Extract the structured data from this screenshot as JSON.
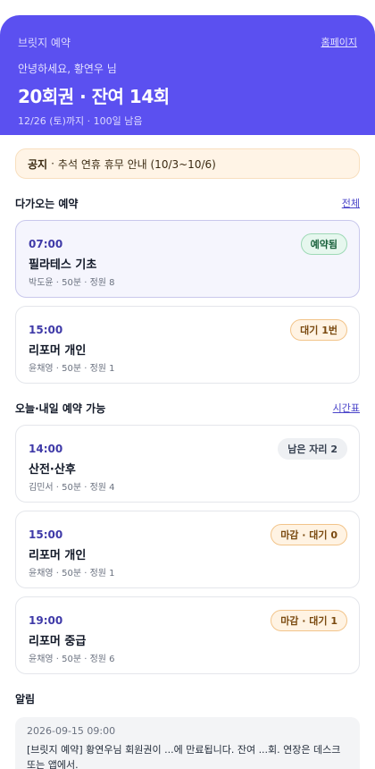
{
  "header": {
    "brand": "브릿지 예약",
    "home_link": "홈페이지",
    "greeting": "안녕하세요, 황연우 님",
    "pass_title": "20회권 · 잔여 14회",
    "pass_sub": "12/26 (토)까지 · 100일 남음"
  },
  "notice": {
    "label": "공지",
    "text": "추석 연휴 휴무 안내 (10/3~10/6)"
  },
  "upcoming": {
    "title": "다가오는 예약",
    "link": "전체",
    "items": [
      {
        "time": "07:00",
        "name": "필라테스 기초",
        "meta": "박도윤 · 50분 · 정원 8",
        "badge": "예약됨"
      },
      {
        "time": "15:00",
        "name": "리포머 개인",
        "meta": "윤채영 · 50분 · 정원 1",
        "badge": "대기 1번"
      }
    ]
  },
  "available": {
    "title": "오늘·내일 예약 가능",
    "link": "시간표",
    "items": [
      {
        "time": "14:00",
        "name": "산전·산후",
        "meta": "김민서 · 50분 · 정원 4",
        "badge": "남은 자리 2"
      },
      {
        "time": "15:00",
        "name": "리포머 개인",
        "meta": "윤채영 · 50분 · 정원 1",
        "badge": "마감 · 대기 0"
      },
      {
        "time": "19:00",
        "name": "리포머 중급",
        "meta": "윤채영 · 50분 · 정원 6",
        "badge": "마감 · 대기 1"
      }
    ]
  },
  "alarm": {
    "title": "알림",
    "date": "2026-09-15 09:00",
    "text": "[브릿지 예약] 황연우님 회원권이 ...에 만료됩니다. 잔여 ...회. 연장은 데스크 또는 앱에서."
  },
  "colors": {
    "header_bg": "#5b50f0",
    "accent": "#3f3aa8",
    "notice_bg": "#fff4e6",
    "badge_booked": "#e6f7ee",
    "badge_wait": "#fff3e3",
    "badge_seats": "#eef0f3"
  }
}
